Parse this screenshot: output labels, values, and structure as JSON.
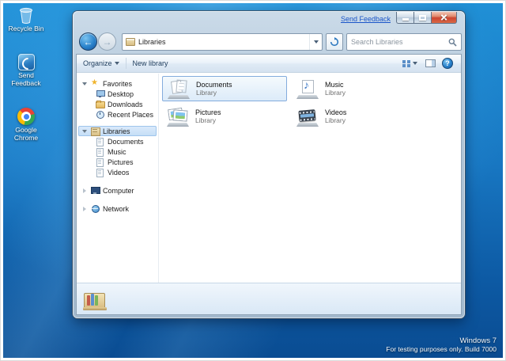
{
  "desktop": {
    "icons": [
      {
        "label": "Recycle Bin"
      },
      {
        "label": "Send Feedback"
      },
      {
        "label": "Google Chrome"
      }
    ],
    "watermark_line1": "Windows 7",
    "watermark_line2": "For testing purposes only. Build 7000"
  },
  "window": {
    "send_feedback_link": "Send Feedback",
    "address_text": "Libraries",
    "search_placeholder": "Search Libraries",
    "toolbar": {
      "organize": "Organize",
      "new_library": "New library"
    },
    "sidebar": {
      "favorites_label": "Favorites",
      "favorites_items": [
        "Desktop",
        "Downloads",
        "Recent Places"
      ],
      "libraries_label": "Libraries",
      "libraries_items": [
        "Documents",
        "Music",
        "Pictures",
        "Videos"
      ],
      "computer_label": "Computer",
      "network_label": "Network"
    },
    "items": [
      {
        "title": "Documents",
        "subtitle": "Library"
      },
      {
        "title": "Music",
        "subtitle": "Library"
      },
      {
        "title": "Pictures",
        "subtitle": "Library"
      },
      {
        "title": "Videos",
        "subtitle": "Library"
      }
    ]
  },
  "colors": {
    "selection_border": "#84acdd",
    "accent_blue": "#2f7ac0",
    "close_button_red": "#cc4430",
    "desktop_blue": "#1877c2"
  }
}
